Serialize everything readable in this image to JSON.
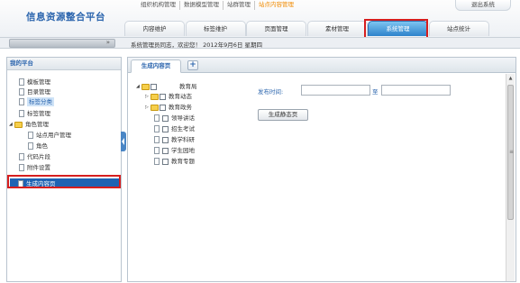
{
  "app": {
    "title": "信息资源整合平台"
  },
  "top_links": [
    {
      "label": "组织机构管理",
      "active": false
    },
    {
      "label": "数据模型管理",
      "active": false
    },
    {
      "label": "站群管理",
      "active": false
    },
    {
      "label": "站点内容管理",
      "active": true
    }
  ],
  "logout_label": "退出系统",
  "nav_tabs": [
    {
      "label": "内容维护",
      "active": false
    },
    {
      "label": "标签维护",
      "active": false
    },
    {
      "label": "页面管理",
      "active": false
    },
    {
      "label": "素材管理",
      "active": false
    },
    {
      "label": "系统管理",
      "active": true
    },
    {
      "label": "站点统计",
      "active": false
    }
  ],
  "status_bar": {
    "welcome": "系统管理员同志，欢迎您！   2012年9月6日  星期四"
  },
  "sidebar": {
    "title": "我的平台",
    "items": [
      {
        "label": "模板管理"
      },
      {
        "label": "目录管理"
      },
      {
        "label": "标签分类"
      },
      {
        "label": "标签管理"
      },
      {
        "label": "角色管理"
      },
      {
        "label": "站点用户管理"
      },
      {
        "label": "角色"
      },
      {
        "label": "代码片段"
      },
      {
        "label": "附件设置"
      },
      {
        "label": "生成内容页"
      }
    ]
  },
  "main": {
    "tab_label": "生成内容页",
    "add_tab": "+",
    "tree": {
      "root": "教育局",
      "children": [
        {
          "label": "教育动态"
        },
        {
          "label": "教育政务"
        },
        {
          "label": "领导讲话"
        },
        {
          "label": "招生考试"
        },
        {
          "label": "教学科研"
        },
        {
          "label": "学生园地"
        },
        {
          "label": "教育专题"
        }
      ]
    },
    "form": {
      "publish_label": "发布时间:",
      "to_label": "至",
      "start_value": "",
      "end_value": "",
      "generate_button": "生成静态页"
    }
  },
  "colors": {
    "accent_blue": "#2e83cb",
    "title_blue": "#2a64ad",
    "highlight_red": "#d61e1e",
    "active_orange": "#f08a00",
    "selected_bg": "#1f63b3"
  }
}
